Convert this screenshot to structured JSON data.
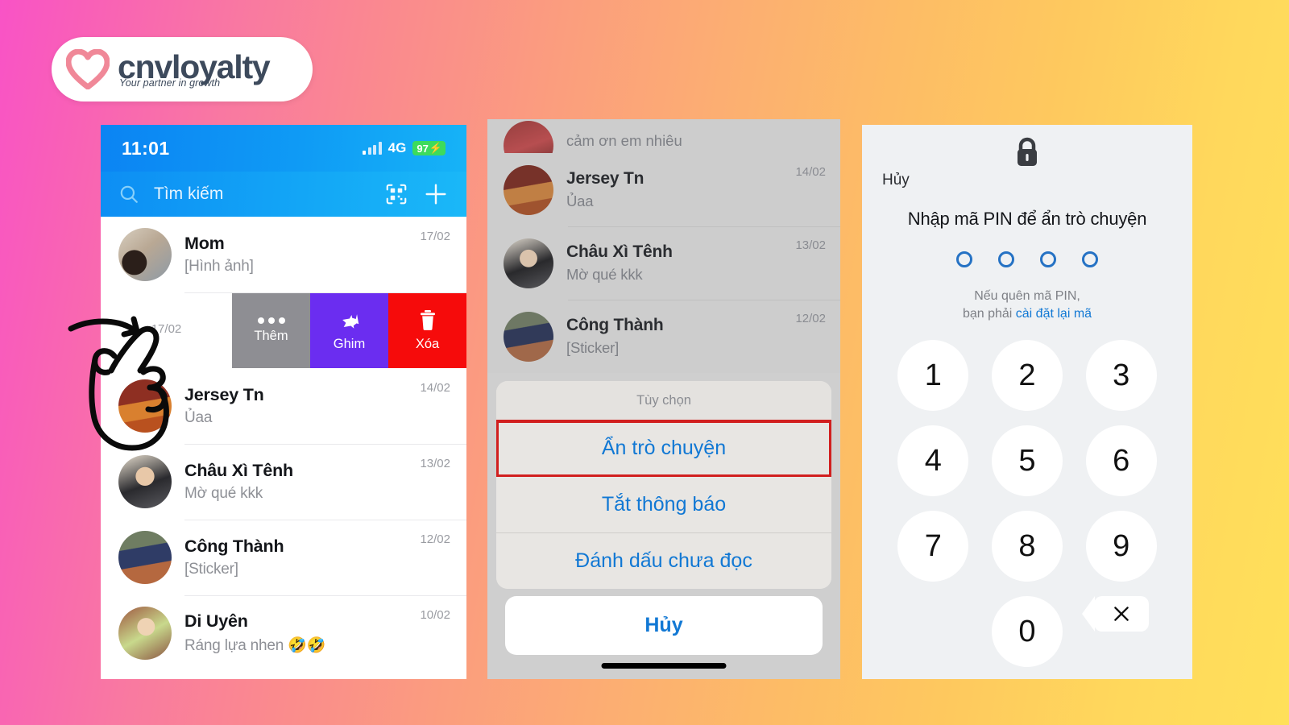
{
  "brand": {
    "name": "cnvloyalty",
    "tagline": "Your partner in growth",
    "heart_color": "#f08898",
    "text_color": "#3d4a5c"
  },
  "background": {
    "gradient_from": "#f953c6",
    "gradient_mid": "#fb9d7e",
    "gradient_to": "#ffe05a"
  },
  "screen1": {
    "status": {
      "time": "11:01",
      "network": "4G",
      "battery": "97",
      "battery_charging": "⚡",
      "battery_color": "#3ddb5c"
    },
    "search": {
      "placeholder": "Tìm kiếm",
      "search_icon": "search-icon",
      "qr_icon": "qr-scan-icon",
      "plus_icon": "plus-icon"
    },
    "chats": [
      {
        "name": "Mom",
        "message": "[Hình ảnh]",
        "date": "17/02"
      },
      {
        "name": "Jersey Tn",
        "message": "Ủaa",
        "date": "14/02"
      },
      {
        "name": "Châu Xì Tênh",
        "message": "Mờ qué kkk",
        "date": "13/02"
      },
      {
        "name": "Công Thành",
        "message": "[Sticker]",
        "date": "12/02"
      },
      {
        "name": "Di Uyên",
        "message": "Ráng lựa nhen 🤣🤣",
        "date": "10/02"
      }
    ],
    "swipe_row": {
      "date": "17/02",
      "actions": [
        {
          "label": "Thêm",
          "icon": "more-dots-icon",
          "color": "#8e8e93"
        },
        {
          "label": "Ghim",
          "icon": "pin-icon",
          "color": "#6b2df0"
        },
        {
          "label": "Xóa",
          "icon": "trash-icon",
          "color": "#f60b0b"
        }
      ]
    },
    "annotation": "hand-pointer-swipe-doodle"
  },
  "screen2": {
    "partial_row": {
      "message": "cảm ơn em nhiêu"
    },
    "chats": [
      {
        "name": "Jersey Tn",
        "message": "Ủaa",
        "date": "14/02"
      },
      {
        "name": "Châu Xì Tênh",
        "message": "Mờ qué kkk",
        "date": "13/02"
      },
      {
        "name": "Công Thành",
        "message": "[Sticker]",
        "date": "12/02"
      }
    ],
    "sheet": {
      "title": "Tùy chọn",
      "items": [
        {
          "label": "Ẩn trò chuyện",
          "highlighted": true
        },
        {
          "label": "Tắt thông báo",
          "highlighted": false
        },
        {
          "label": "Đánh dấu chưa đọc",
          "highlighted": false
        }
      ],
      "cancel": "Hủy",
      "highlight_color": "#d11f1f",
      "action_color": "#1178d4"
    }
  },
  "screen3": {
    "lock_icon": "lock-icon",
    "cancel": "Hủy",
    "title": "Nhập mã PIN để ẩn trò chuyện",
    "pin_length": 4,
    "pin_entered": 0,
    "hint_line1": "Nếu quên mã PIN,",
    "hint_line2_prefix": "bạn phải ",
    "hint_link": "cài đặt lại mã",
    "keys": [
      "1",
      "2",
      "3",
      "4",
      "5",
      "6",
      "7",
      "8",
      "9"
    ],
    "key_zero": "0",
    "delete_icon": "backspace-icon",
    "dot_color": "#2572c4",
    "link_color": "#1178d4"
  }
}
